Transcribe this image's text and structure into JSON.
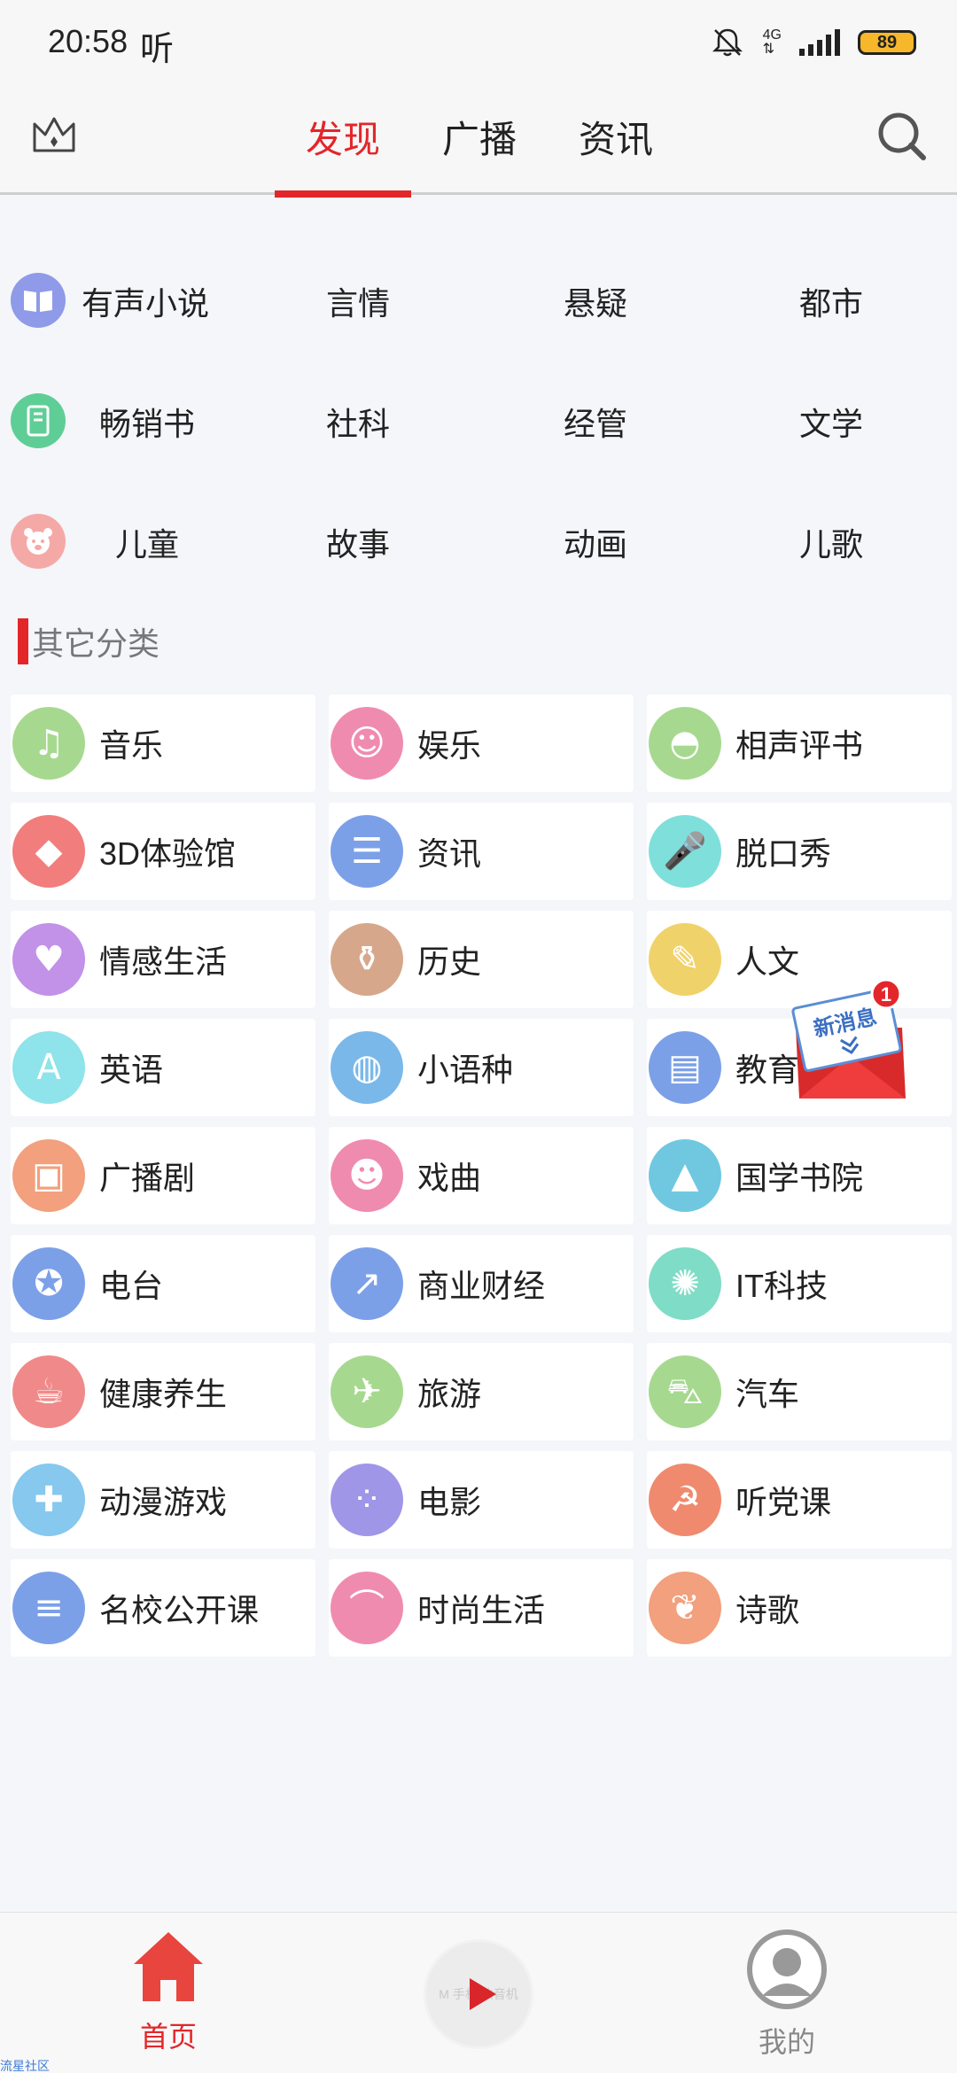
{
  "status": {
    "time": "20:58",
    "app_glyph": "听",
    "network": "4G",
    "battery": "89"
  },
  "topnav": {
    "tabs": [
      {
        "label": "发现",
        "active": true
      },
      {
        "label": "广播",
        "active": false
      },
      {
        "label": "资讯",
        "active": false
      }
    ]
  },
  "primary_rows": [
    {
      "icon": "book-icon",
      "color": "#8f9ae8",
      "items": [
        "有声小说",
        "言情",
        "悬疑",
        "都市"
      ]
    },
    {
      "icon": "notebook-icon",
      "color": "#5fce96",
      "items": [
        "畅销书",
        "社科",
        "经管",
        "文学"
      ]
    },
    {
      "icon": "bear-icon",
      "color": "#f5a9a6",
      "items": [
        "儿童",
        "故事",
        "动画",
        "儿歌"
      ]
    }
  ],
  "section_title": "其它分类",
  "categories": [
    {
      "label": "音乐",
      "icon": "music-note-icon",
      "color": "#a6d98f"
    },
    {
      "label": "娱乐",
      "icon": "smile-icon",
      "color": "#f08bb0"
    },
    {
      "label": "相声评书",
      "icon": "fan-icon",
      "color": "#a6d98f"
    },
    {
      "label": "3D体验馆",
      "icon": "cube-icon",
      "color": "#f27d7d"
    },
    {
      "label": "资讯",
      "icon": "document-icon",
      "color": "#7ca0e8"
    },
    {
      "label": "脱口秀",
      "icon": "microphone-icon",
      "color": "#7fdfdb"
    },
    {
      "label": "情感生活",
      "icon": "heart-icon",
      "color": "#c291e8"
    },
    {
      "label": "历史",
      "icon": "vase-icon",
      "color": "#d7a78b"
    },
    {
      "label": "人文",
      "icon": "brush-icon",
      "color": "#f0d26a"
    },
    {
      "label": "英语",
      "icon": "english-card-icon",
      "color": "#8fe3ea"
    },
    {
      "label": "小语种",
      "icon": "planet-icon",
      "color": "#7ab8ea"
    },
    {
      "label": "教育",
      "icon": "id-card-icon",
      "color": "#7ca0e8"
    },
    {
      "label": "广播剧",
      "icon": "radio-icon",
      "color": "#f2a07d"
    },
    {
      "label": "戏曲",
      "icon": "opera-mask-icon",
      "color": "#f08bb0"
    },
    {
      "label": "国学书院",
      "icon": "graduation-cap-icon",
      "color": "#6fc8e0"
    },
    {
      "label": "电台",
      "icon": "badge-icon",
      "color": "#7ca0e8"
    },
    {
      "label": "商业财经",
      "icon": "chart-icon",
      "color": "#7ca0e8"
    },
    {
      "label": "IT科技",
      "icon": "atom-icon",
      "color": "#7fdcc6"
    },
    {
      "label": "健康养生",
      "icon": "cup-icon",
      "color": "#f08a8a"
    },
    {
      "label": "旅游",
      "icon": "airplane-icon",
      "color": "#a6d98f"
    },
    {
      "label": "汽车",
      "icon": "car-icon",
      "color": "#a6d98f"
    },
    {
      "label": "动漫游戏",
      "icon": "gamepad-icon",
      "color": "#86c8ee"
    },
    {
      "label": "电影",
      "icon": "film-reel-icon",
      "color": "#9f96e8"
    },
    {
      "label": "听党课",
      "icon": "hammer-sickle-icon",
      "color": "#ef8a6f"
    },
    {
      "label": "名校公开课",
      "icon": "chat-doc-icon",
      "color": "#7ca0e8"
    },
    {
      "label": "时尚生活",
      "icon": "high-heel-icon",
      "color": "#f08bb0"
    },
    {
      "label": "诗歌",
      "icon": "leaf-icon",
      "color": "#f2a07d"
    }
  ],
  "new_message": {
    "text": "新消息",
    "count": "1"
  },
  "bottomnav": {
    "home_label": "首页",
    "player_text": "M 手机 收音机",
    "me_label": "我的"
  },
  "watermark": "流星社区",
  "colors": {
    "accent": "#e3262a"
  }
}
